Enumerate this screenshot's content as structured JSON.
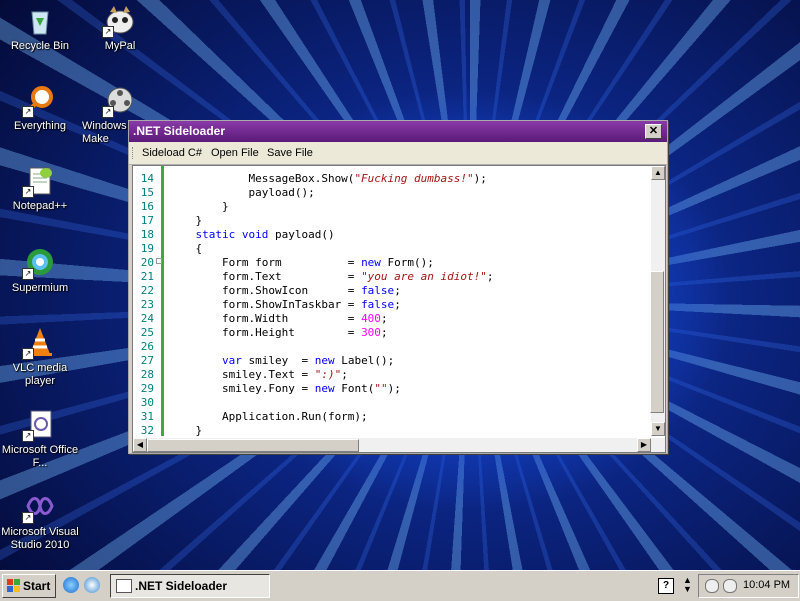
{
  "desktop": {
    "icons": [
      {
        "label": "Recycle Bin",
        "icon": "recycle-bin-icon"
      },
      {
        "label": "MyPal",
        "icon": "mypal-browser-icon"
      },
      {
        "label": "Everything",
        "icon": "everything-search-icon"
      },
      {
        "label": "Windows Make",
        "icon": "windows-movie-maker-icon"
      },
      {
        "label": "Notepad++",
        "icon": "notepad-plus-plus-icon"
      },
      {
        "label": "Supermium",
        "icon": "supermium-browser-icon"
      },
      {
        "label": "VLC media player",
        "icon": "vlc-cone-icon"
      },
      {
        "label": "Microsoft Office F...",
        "icon": "office-file-icon"
      },
      {
        "label": "Microsoft Visual Studio 2010",
        "icon": "visual-studio-icon"
      }
    ]
  },
  "window": {
    "title": ".NET Sideloader",
    "close": "✕",
    "menu": [
      "Sideload C#",
      "Open File",
      "Save File"
    ],
    "line_numbers": [
      "14",
      "15",
      "16",
      "17",
      "18",
      "19",
      "20",
      "21",
      "22",
      "23",
      "24",
      "25",
      "26",
      "27",
      "28",
      "29",
      "30",
      "31",
      "32"
    ]
  },
  "taskbar": {
    "start_label": "Start",
    "task_label": ".NET Sideloader",
    "clock": "10:04 PM",
    "help": "?"
  },
  "colors": {
    "titlebar": "#6a2a88",
    "keyword": "#0000ff",
    "string": "#a31515",
    "number": "#ff00ff",
    "line_number": "#008080",
    "change_bar": "#3caa3c"
  }
}
